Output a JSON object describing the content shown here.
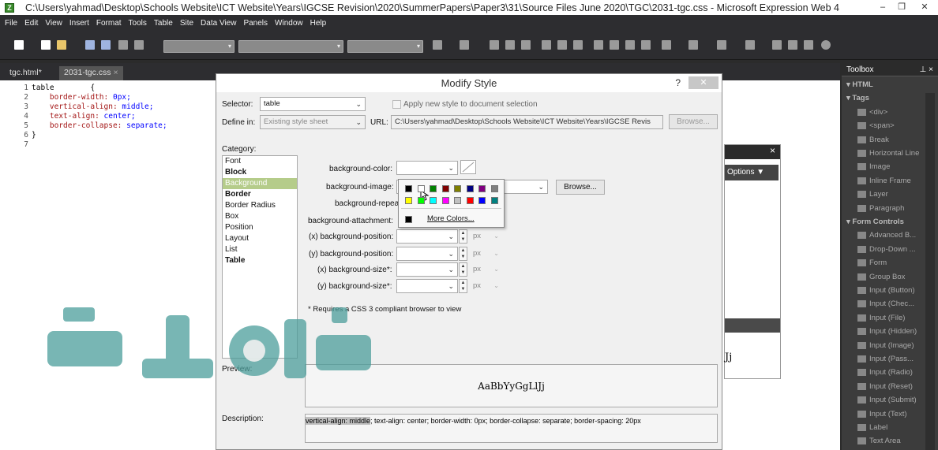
{
  "window": {
    "title": "C:\\Users\\yahmad\\Desktop\\Schools Website\\ICT Website\\Years\\IGCSE Revision\\2020\\SummerPapers\\Paper3\\31\\Source Files June 2020\\TGC\\2031-tgc.css - Microsoft Expression Web 4",
    "minimize": "–",
    "restore": "❐",
    "close": "✕"
  },
  "menu": [
    "File",
    "Edit",
    "View",
    "Insert",
    "Format",
    "Tools",
    "Table",
    "Site",
    "Data View",
    "Panels",
    "Window",
    "Help"
  ],
  "tabs": [
    {
      "label": "tgc.html*"
    },
    {
      "label": "2031-tgc.css",
      "close": "×"
    }
  ],
  "code": [
    {
      "n": "1",
      "sel": "table",
      "rest": "        {"
    },
    {
      "n": "2",
      "prop": "border-width:",
      "val": " 0px;"
    },
    {
      "n": "3",
      "prop": "vertical-align:",
      "val": " middle;"
    },
    {
      "n": "4",
      "prop": "text-align:",
      "val": " center;"
    },
    {
      "n": "5",
      "prop": "border-collapse:",
      "val": " separate;"
    },
    {
      "n": "6",
      "sel": "}",
      "rest": ""
    },
    {
      "n": "7",
      "sel": "",
      "rest": ""
    }
  ],
  "behind_panel": {
    "close": "×",
    "options": "Options ▼",
    "text": "Jj"
  },
  "toolbox": {
    "title": "Toolbox",
    "pin": "⊥ ×",
    "groups": [
      {
        "label": "▾ HTML",
        "section": true
      },
      {
        "label": "▾ Tags",
        "section": true
      },
      {
        "label": "<div>"
      },
      {
        "label": "<span>"
      },
      {
        "label": "Break"
      },
      {
        "label": "Horizontal Line"
      },
      {
        "label": "Image"
      },
      {
        "label": "Inline Frame"
      },
      {
        "label": "Layer"
      },
      {
        "label": "Paragraph"
      },
      {
        "label": "▾ Form Controls",
        "section": true
      },
      {
        "label": "Advanced B..."
      },
      {
        "label": "Drop-Down ..."
      },
      {
        "label": "Form"
      },
      {
        "label": "Group Box"
      },
      {
        "label": "Input (Button)"
      },
      {
        "label": "Input (Chec..."
      },
      {
        "label": "Input (File)"
      },
      {
        "label": "Input (Hidden)"
      },
      {
        "label": "Input (Image)"
      },
      {
        "label": "Input (Pass..."
      },
      {
        "label": "Input (Radio)"
      },
      {
        "label": "Input (Reset)"
      },
      {
        "label": "Input (Submit)"
      },
      {
        "label": "Input (Text)"
      },
      {
        "label": "Label"
      },
      {
        "label": "Text Area"
      }
    ]
  },
  "dialog": {
    "title": "Modify Style",
    "help": "?",
    "close": "✕",
    "selector_label": "Selector:",
    "selector_value": "table",
    "apply_new": "Apply new style to document selection",
    "define_label": "Define in:",
    "define_value": "Existing style sheet",
    "url_label": "URL:",
    "url_value": "C:\\Users\\yahmad\\Desktop\\Schools Website\\ICT Website\\Years\\IGCSE Revis",
    "browse_url": "Browse...",
    "category_label": "Category:",
    "categories": [
      {
        "label": "Font",
        "bold": false
      },
      {
        "label": "Block",
        "bold": true
      },
      {
        "label": "Background",
        "bold": false,
        "selected": true
      },
      {
        "label": "Border",
        "bold": true
      },
      {
        "label": "Border Radius",
        "bold": false
      },
      {
        "label": "Box",
        "bold": false
      },
      {
        "label": "Position",
        "bold": false
      },
      {
        "label": "Layout",
        "bold": false
      },
      {
        "label": "List",
        "bold": false
      },
      {
        "label": "Table",
        "bold": true
      }
    ],
    "fields": {
      "bg_color": "background-color:",
      "bg_image": "background-image:",
      "bg_repeat": "background-repeat:",
      "bg_attachment": "background-attachment:",
      "x_pos": "(x) background-position:",
      "y_pos": "(y) background-position:",
      "x_size": "(x) background-size*:",
      "y_size": "(y) background-size*:"
    },
    "browse_image": "Browse...",
    "unit": "px",
    "css3_note": "* Requires a CSS 3 compliant browser to view",
    "preview_label": "Preview:",
    "preview_text": "AaBbYyGgLlJj",
    "description_label": "Description:",
    "description_highlight": "vertical-align: middle",
    "description_rest": "; text-align: center; border-width: 0px; border-collapse: separate; border-spacing: 20px"
  },
  "color_picker": {
    "row1": [
      "#000000",
      "#ffffff",
      "#008000",
      "#800000",
      "#808000",
      "#000080",
      "#800080",
      "#808080"
    ],
    "row2": [
      "#ffff00",
      "#00ff00",
      "#00ffff",
      "#ff00ff",
      "#c0c0c0",
      "#ff0000",
      "#0000ff",
      "#008080"
    ],
    "more_colors": "More Colors..."
  },
  "watermark_color": "#4c9e9b"
}
